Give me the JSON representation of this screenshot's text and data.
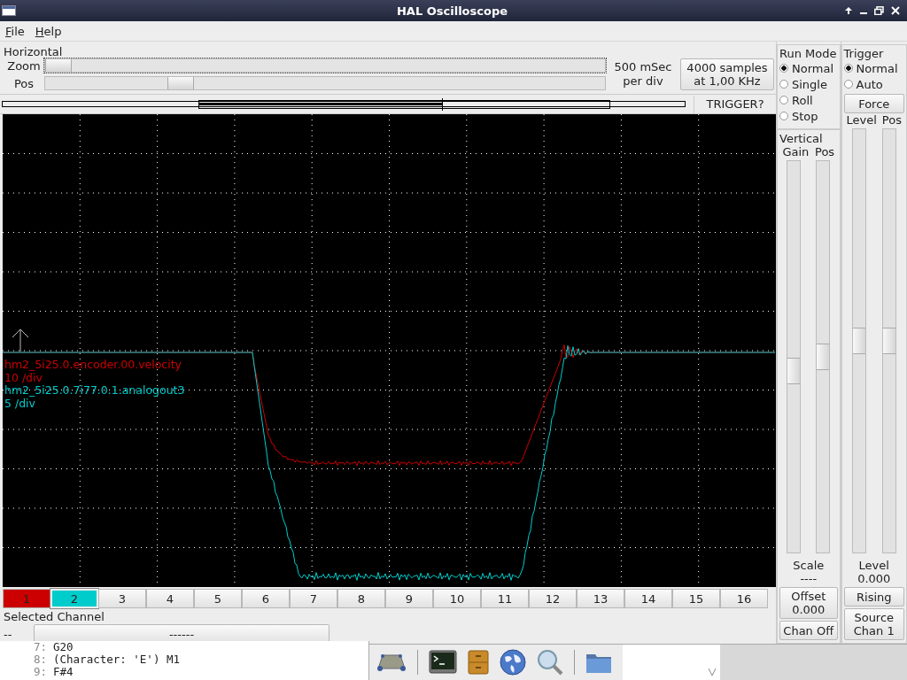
{
  "window": {
    "title": "HAL Oscilloscope"
  },
  "menu": [
    "File",
    "Help"
  ],
  "horizontal": {
    "title": "Horizontal",
    "zoom": {
      "label": "Zoom",
      "level": 0.0
    },
    "pos": {
      "label": "Pos",
      "level": 0.23
    },
    "rate": "500 mSec per div",
    "samples_button": "4000 samples at 1,00 KHz",
    "trigger_status": "TRIGGER?"
  },
  "traces": [
    {
      "name": "hm2_5i25.0.encoder.00.velocity",
      "scale": "10 /div",
      "color": "#cc0000"
    },
    {
      "name": "hm2_5i25.0.7i77.0.1.analogout3",
      "scale": "5 /div",
      "color": "#00cccc"
    }
  ],
  "channels": [
    {
      "label": "1",
      "selected": false,
      "color": "#cc0000"
    },
    {
      "label": "2",
      "selected": true,
      "color": "#00cccc"
    },
    {
      "label": "3",
      "selected": false
    },
    {
      "label": "4",
      "selected": false
    },
    {
      "label": "5",
      "selected": false
    },
    {
      "label": "6",
      "selected": false
    },
    {
      "label": "7",
      "selected": false
    },
    {
      "label": "8",
      "selected": false
    },
    {
      "label": "9",
      "selected": false
    },
    {
      "label": "10",
      "selected": false
    },
    {
      "label": "11",
      "selected": false
    },
    {
      "label": "12",
      "selected": false
    },
    {
      "label": "13",
      "selected": false
    },
    {
      "label": "14",
      "selected": false
    },
    {
      "label": "15",
      "selected": false
    },
    {
      "label": "16",
      "selected": false
    }
  ],
  "selected_channel": {
    "title": "Selected Channel",
    "number": "--",
    "name_button": "------"
  },
  "run_mode": {
    "title": "Run Mode",
    "options": [
      {
        "label": "Normal",
        "selected": true
      },
      {
        "label": "Single",
        "selected": false
      },
      {
        "label": "Roll",
        "selected": false
      },
      {
        "label": "Stop",
        "selected": false
      }
    ]
  },
  "vertical": {
    "title": "Vertical",
    "gain": {
      "label": "Gain",
      "level": 0.46
    },
    "pos": {
      "label": "Pos",
      "level": 0.5
    },
    "scale_label": "Scale",
    "scale_value": "----",
    "offset_button": "Offset 0.000",
    "chan_off_button": "Chan Off"
  },
  "trigger": {
    "title": "Trigger",
    "options": [
      {
        "label": "Normal",
        "selected": true
      },
      {
        "label": "Auto",
        "selected": false
      }
    ],
    "force_button": "Force",
    "level": {
      "label": "Level",
      "level": 0.5
    },
    "pos": {
      "label": "Pos",
      "level": 0.5
    },
    "level_label": "Level",
    "level_value": "0.000",
    "edge_button": "Rising",
    "source_button": "Source Chan  1"
  },
  "code_lines": [
    {
      "number": "7:",
      "text": "G20"
    },
    {
      "number": "8:",
      "text": "(Character: 'E') M1"
    },
    {
      "number": "9:",
      "text": "F#4"
    }
  ]
}
